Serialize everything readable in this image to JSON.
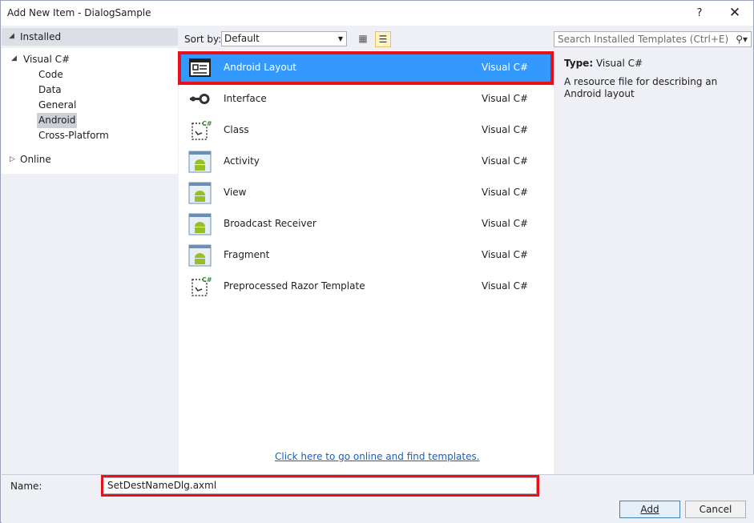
{
  "window": {
    "title": "Add New Item - DialogSample",
    "help_label": "?",
    "close_label": "✕"
  },
  "tree": {
    "installed": "Installed",
    "visual_csharp": "Visual C#",
    "children": [
      "Code",
      "Data",
      "General",
      "Android",
      "Cross-Platform"
    ],
    "selected_child": "Android",
    "online": "Online"
  },
  "toolbar": {
    "sort_label": "Sort by:",
    "sort_value": "Default",
    "grid_view_icon": "grid-view-icon",
    "list_view_icon": "list-view-icon"
  },
  "search": {
    "placeholder": "Search Installed Templates (Ctrl+E)"
  },
  "templates": [
    {
      "name": "Android Layout",
      "lang": "Visual C#",
      "icon": "layout-icon",
      "selected": true
    },
    {
      "name": "Interface",
      "lang": "Visual C#",
      "icon": "interface-icon"
    },
    {
      "name": "Class",
      "lang": "Visual C#",
      "icon": "class-icon"
    },
    {
      "name": "Activity",
      "lang": "Visual C#",
      "icon": "android-icon"
    },
    {
      "name": "View",
      "lang": "Visual C#",
      "icon": "android-icon"
    },
    {
      "name": "Broadcast Receiver",
      "lang": "Visual C#",
      "icon": "android-icon"
    },
    {
      "name": "Fragment",
      "lang": "Visual C#",
      "icon": "android-icon"
    },
    {
      "name": "Preprocessed Razor Template",
      "lang": "Visual C#",
      "icon": "class-icon"
    }
  ],
  "online_link": "Click here to go online and find templates.",
  "details": {
    "type_label": "Type:",
    "type_value": "Visual C#",
    "description": "A resource file for describing an Android layout"
  },
  "bottom": {
    "name_label": "Name:",
    "name_value": "SetDestNameDlg.axml",
    "add_label": "Add",
    "cancel_label": "Cancel"
  },
  "colors": {
    "selection": "#3399ff",
    "highlight_outline": "#e8111b",
    "link": "#1a5fbf",
    "android_green": "#97c024"
  }
}
